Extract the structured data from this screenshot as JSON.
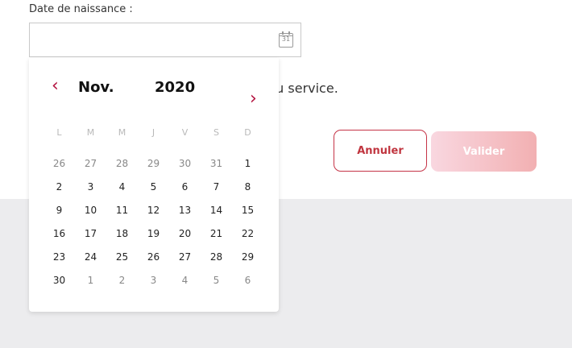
{
  "form": {
    "dob_label": "Date de naissance :",
    "dob_value": "",
    "calendar_icon_text": "31",
    "service_text": "du service."
  },
  "buttons": {
    "cancel": "Annuler",
    "validate": "Valider"
  },
  "calendar": {
    "month": "Nov.",
    "year": "2020",
    "weekdays": [
      "L",
      "M",
      "M",
      "J",
      "V",
      "S",
      "D"
    ],
    "weeks": [
      [
        {
          "d": "26",
          "o": true
        },
        {
          "d": "27",
          "o": true
        },
        {
          "d": "28",
          "o": true
        },
        {
          "d": "29",
          "o": true
        },
        {
          "d": "30",
          "o": true
        },
        {
          "d": "31",
          "o": true
        },
        {
          "d": "1",
          "o": false
        }
      ],
      [
        {
          "d": "2",
          "o": false
        },
        {
          "d": "3",
          "o": false
        },
        {
          "d": "4",
          "o": false
        },
        {
          "d": "5",
          "o": false
        },
        {
          "d": "6",
          "o": false
        },
        {
          "d": "7",
          "o": false
        },
        {
          "d": "8",
          "o": false
        }
      ],
      [
        {
          "d": "9",
          "o": false
        },
        {
          "d": "10",
          "o": false
        },
        {
          "d": "11",
          "o": false
        },
        {
          "d": "12",
          "o": false
        },
        {
          "d": "13",
          "o": false
        },
        {
          "d": "14",
          "o": false
        },
        {
          "d": "15",
          "o": false
        }
      ],
      [
        {
          "d": "16",
          "o": false
        },
        {
          "d": "17",
          "o": false
        },
        {
          "d": "18",
          "o": false
        },
        {
          "d": "19",
          "o": false
        },
        {
          "d": "20",
          "o": false
        },
        {
          "d": "21",
          "o": false
        },
        {
          "d": "22",
          "o": false
        }
      ],
      [
        {
          "d": "23",
          "o": false
        },
        {
          "d": "24",
          "o": false
        },
        {
          "d": "25",
          "o": false
        },
        {
          "d": "26",
          "o": false
        },
        {
          "d": "27",
          "o": false
        },
        {
          "d": "28",
          "o": false
        },
        {
          "d": "29",
          "o": false
        }
      ],
      [
        {
          "d": "30",
          "o": false
        },
        {
          "d": "1",
          "o": true
        },
        {
          "d": "2",
          "o": true
        },
        {
          "d": "3",
          "o": true
        },
        {
          "d": "4",
          "o": true
        },
        {
          "d": "5",
          "o": true
        },
        {
          "d": "6",
          "o": true
        }
      ]
    ]
  },
  "colors": {
    "accent": "#b3123f",
    "cancel_border": "#c53447",
    "validate_gradient_start": "#f9d7e0",
    "validate_gradient_end": "#f2b0b2"
  }
}
